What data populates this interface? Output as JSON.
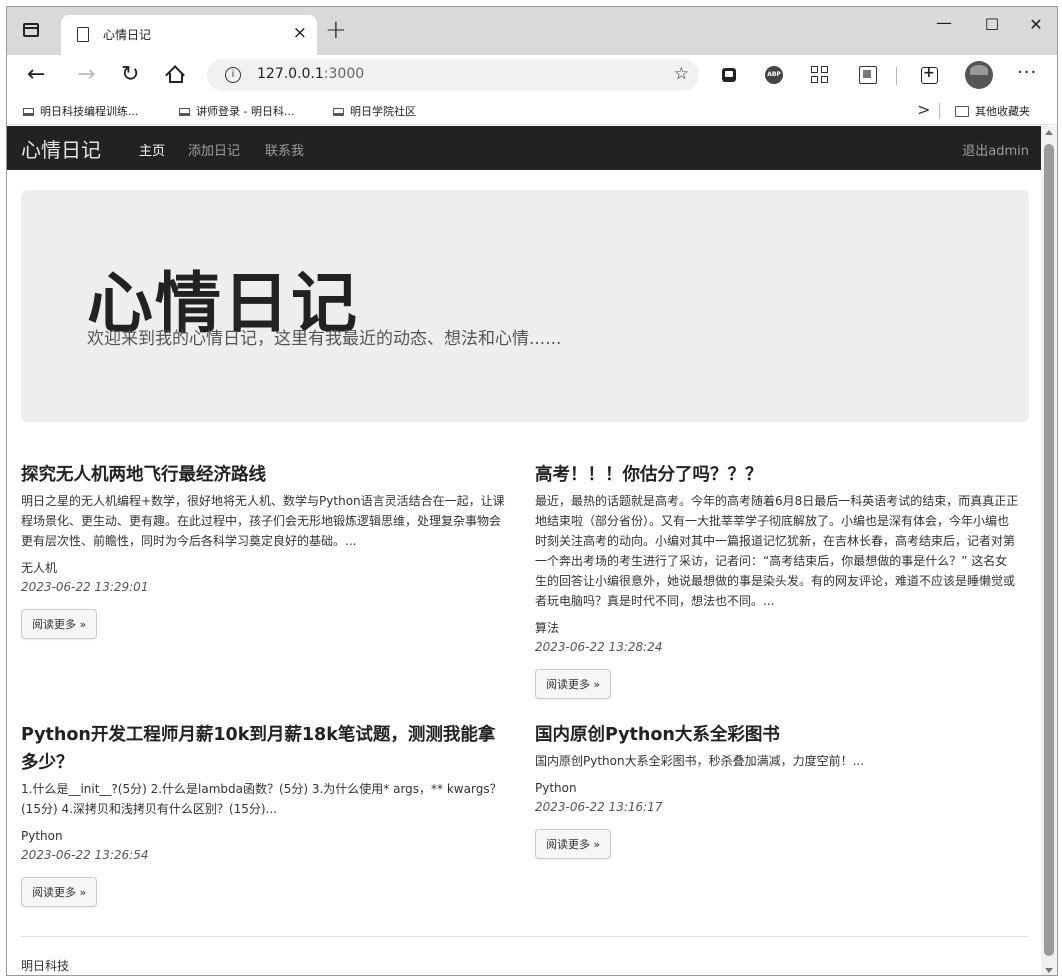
{
  "browser": {
    "tab_title": "心情日记",
    "tab_close": "×",
    "new_tab": "+",
    "minimize": "—",
    "maximize": "☐",
    "close": "✕",
    "url_host": "127.0.0.1",
    "url_port": ":3000",
    "more": "···",
    "bookmarks": [
      {
        "label": "明日科技编程训练..."
      },
      {
        "label": "讲师登录 - 明日科..."
      },
      {
        "label": "明日学院社区"
      }
    ],
    "bookmarks_chevron": ">",
    "other_bookmarks": "其他收藏夹"
  },
  "navbar": {
    "brand": "心情日记",
    "links": [
      "主页",
      "添加日记",
      "联系我"
    ],
    "active_index": 0,
    "logout": "退出admin"
  },
  "jumbotron": {
    "title": "心情日记",
    "subtitle": "欢迎来到我的心情日记，这里有我最近的动态、想法和心情......"
  },
  "posts": [
    {
      "title": "探究无人机两地飞行最经济路线",
      "excerpt": "明日之星的无人机编程+数学，很好地将无人机、数学与Python语言灵活结合在一起，让课程场景化、更生动、更有趣。在此过程中，孩子们会无形地锻炼逻辑思维，处理复杂事物会更有层次性、前瞻性，同时为今后各科学习奠定良好的基础。...",
      "category": "无人机",
      "date": "2023-06-22 13:29:01",
      "button": "阅读更多 »"
    },
    {
      "title": "高考！！！你估分了吗？？？",
      "excerpt": "最近，最热的话题就是高考。今年的高考随着6月8日最后一科英语考试的结束，而真真正正地结束啦（部分省份）。又有一大批莘莘学子彻底解放了。小编也是深有体会，今年小编也时刻关注高考的动向。小编对其中一篇报道记忆犹新，在吉林长春，高考结束后，记者对第一个奔出考场的考生进行了采访，记者问：“高考结束后，你最想做的事是什么？” 这名女生的回答让小编很意外，她说最想做的事是染头发。有的网友评论，难道不应该是睡懒觉或者玩电脑吗？真是时代不同，想法也不同。...",
      "category": "算法",
      "date": "2023-06-22 13:28:24",
      "button": "阅读更多 »"
    },
    {
      "title": "Python开发工程师月薪10k到月薪18k笔试题，测测我能拿多少？",
      "excerpt": "1.什么是__init__?(5分) 2.什么是lambda函数？(5分) 3.为什么使用* args，** kwargs？(15分) 4.深拷贝和浅拷贝有什么区别？(15分)...",
      "category": "Python",
      "date": "2023-06-22 13:26:54",
      "button": "阅读更多 »"
    },
    {
      "title": "国内原创Python大系全彩图书",
      "excerpt": "国内原创Python大系全彩图书，秒杀叠加满减，力度空前！...",
      "category": "Python",
      "date": "2023-06-22 13:16:17",
      "button": "阅读更多 »"
    }
  ],
  "footer": "明日科技"
}
